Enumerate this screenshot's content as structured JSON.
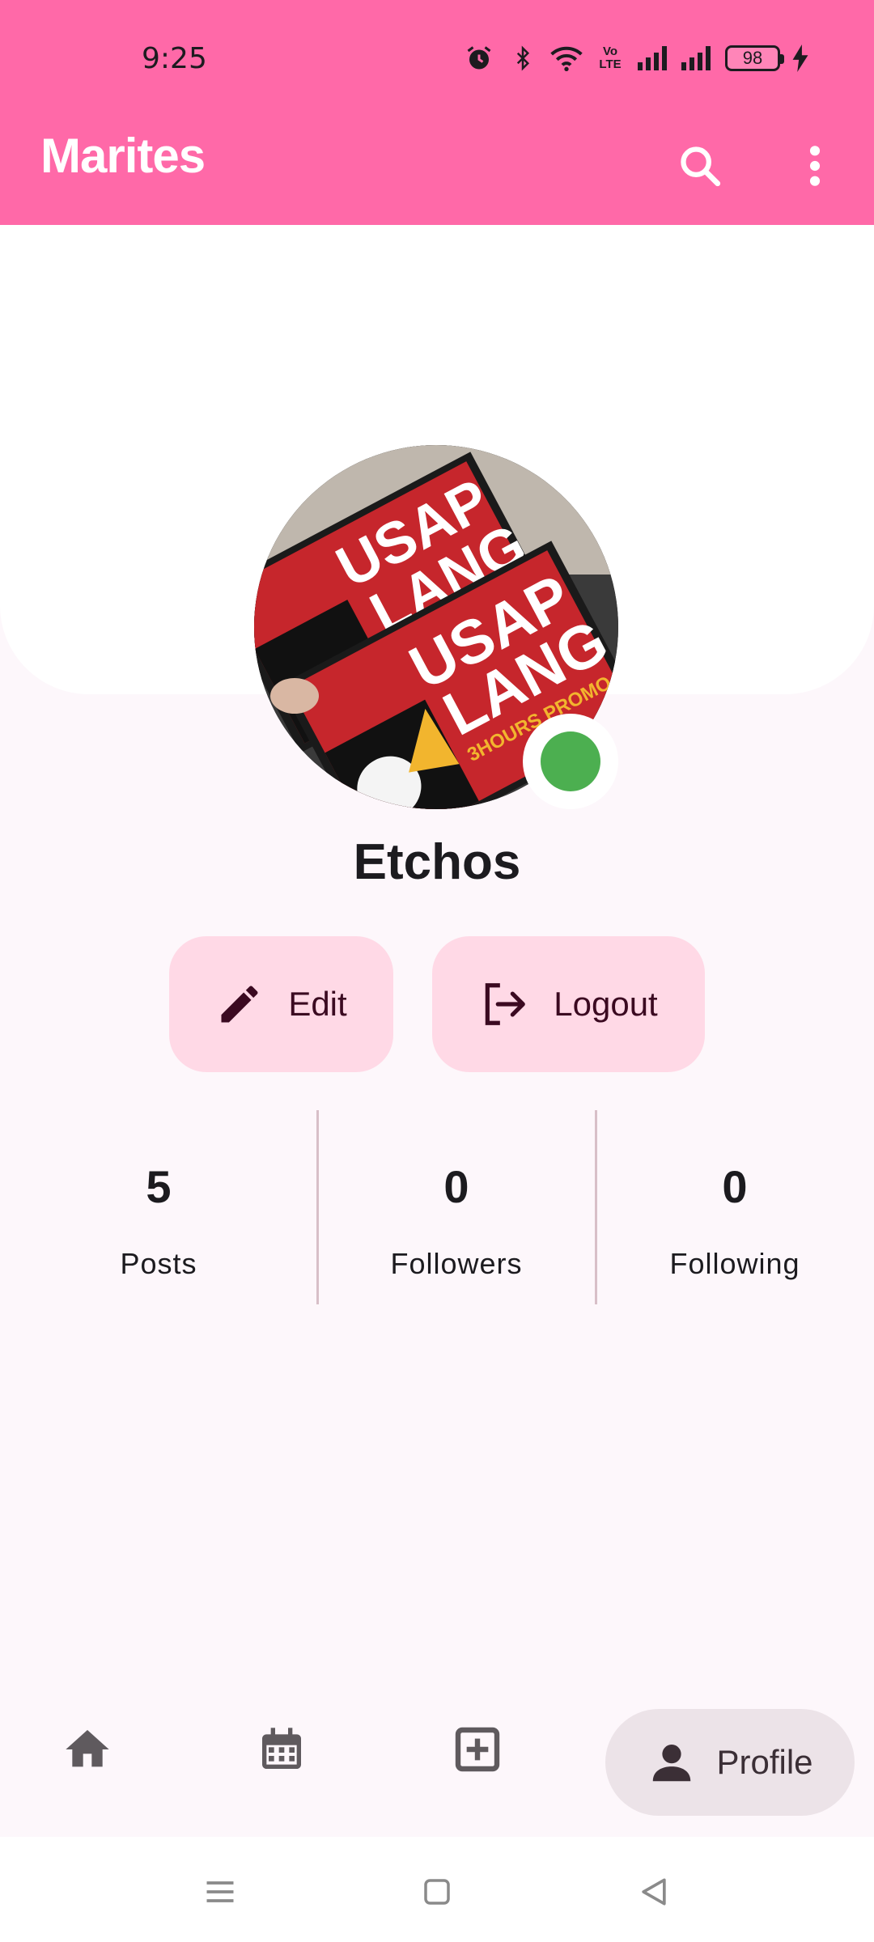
{
  "status_bar": {
    "time": "9:25",
    "battery": "98",
    "volte": "Vo LTE"
  },
  "app_bar": {
    "title": "Marites"
  },
  "profile": {
    "avatar_text_1": "USAP",
    "avatar_text_2": "LANG",
    "avatar_text_3": "3HOURS PROMO",
    "username": "Etchos",
    "online": true
  },
  "actions": {
    "edit_label": "Edit",
    "logout_label": "Logout"
  },
  "stats": {
    "posts_count": "5",
    "posts_label": "Posts",
    "followers_count": "0",
    "followers_label": "Followers",
    "following_count": "0",
    "following_label": "Following"
  },
  "bottom_nav": {
    "profile_label": "Profile",
    "active": "profile"
  },
  "colors": {
    "primary": "#ff69a8",
    "button_bg": "#ffd9e6",
    "online": "#4caf50",
    "background": "#fdf7fb"
  }
}
